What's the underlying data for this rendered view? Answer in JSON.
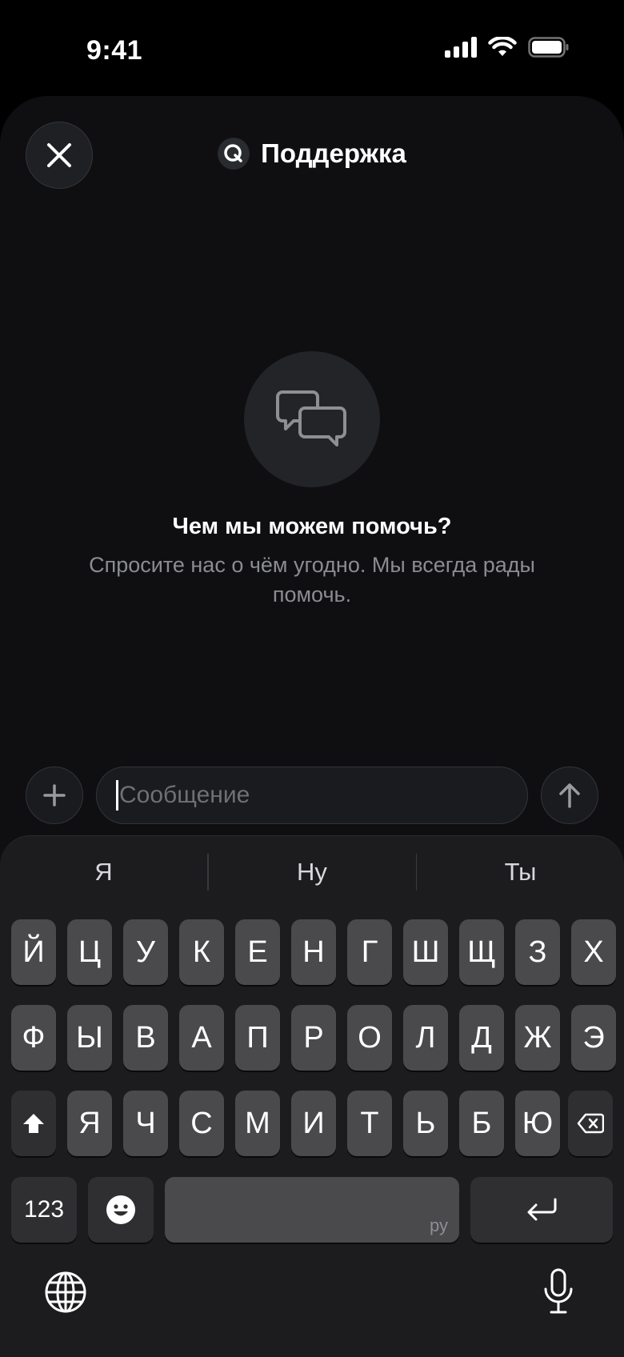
{
  "status_bar": {
    "time": "9:41"
  },
  "header": {
    "title": "Поддержка"
  },
  "empty_state": {
    "title": "Чем мы можем помочь?",
    "subtitle": "Спросите нас о чём угодно. Мы всегда рады помочь."
  },
  "composer": {
    "placeholder": "Сообщение"
  },
  "keyboard": {
    "suggestions": [
      "Я",
      "Ну",
      "Ты"
    ],
    "row1": [
      "Й",
      "Ц",
      "У",
      "К",
      "Е",
      "Н",
      "Г",
      "Ш",
      "Щ",
      "З",
      "Х"
    ],
    "row2": [
      "Ф",
      "Ы",
      "В",
      "А",
      "П",
      "Р",
      "О",
      "Л",
      "Д",
      "Ж",
      "Э"
    ],
    "row3": [
      "Я",
      "Ч",
      "С",
      "М",
      "И",
      "Т",
      "Ь",
      "Б",
      "Ю"
    ],
    "numbers_label": "123",
    "space_lang": "ру"
  },
  "colors": {
    "background": "#000000",
    "sheet": "#0f0f11",
    "key": "#4a4a4d",
    "key_dark": "#2f2f32"
  }
}
